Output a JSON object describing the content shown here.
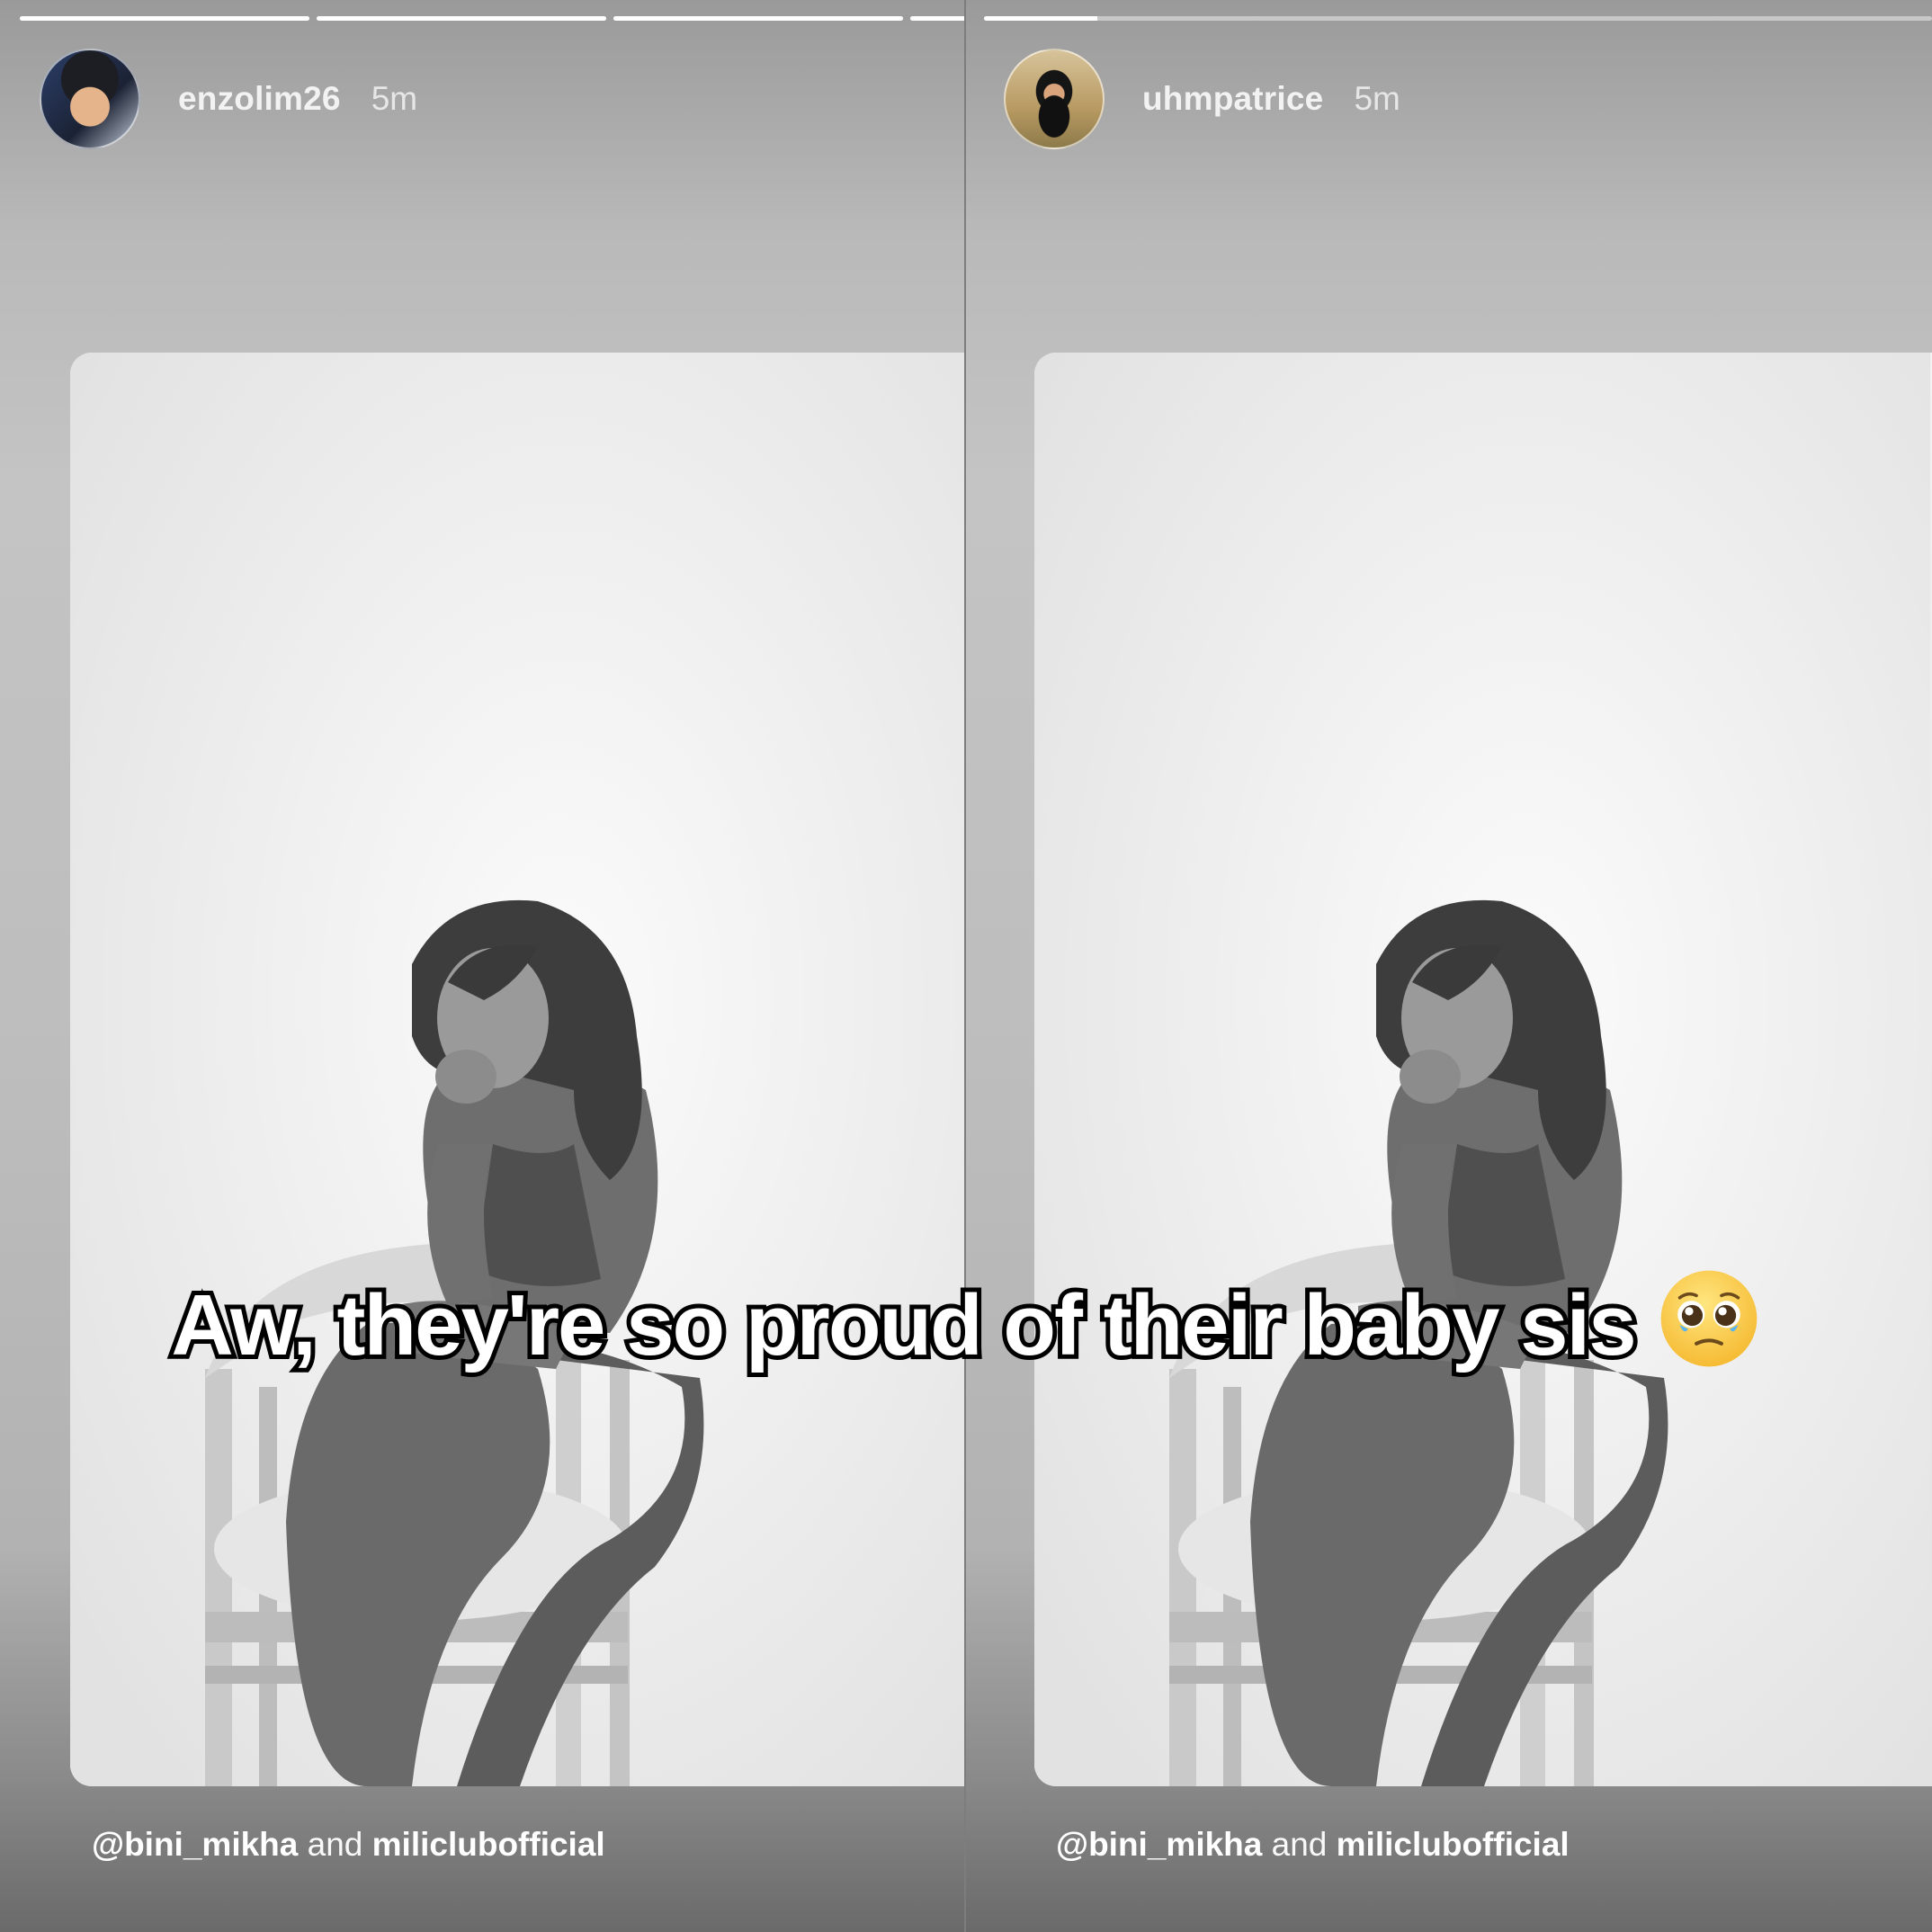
{
  "stories": [
    {
      "username": "enzolim26",
      "time": "5m",
      "progress": [
        1,
        1,
        1,
        1
      ],
      "mention_handle": "@bini_mikha",
      "mention_joiner": "and",
      "mention_account": "miliclubofficial"
    },
    {
      "username": "uhmpatrice",
      "time": "5m",
      "progress": [
        0.12
      ],
      "mention_handle": "@bini_mikha",
      "mention_joiner": "and",
      "mention_account": "miliclubofficial"
    }
  ],
  "caption": {
    "text": "Aw, they're so proud of their baby sis",
    "emoji": "pleading-face-with-tears-emoji"
  }
}
